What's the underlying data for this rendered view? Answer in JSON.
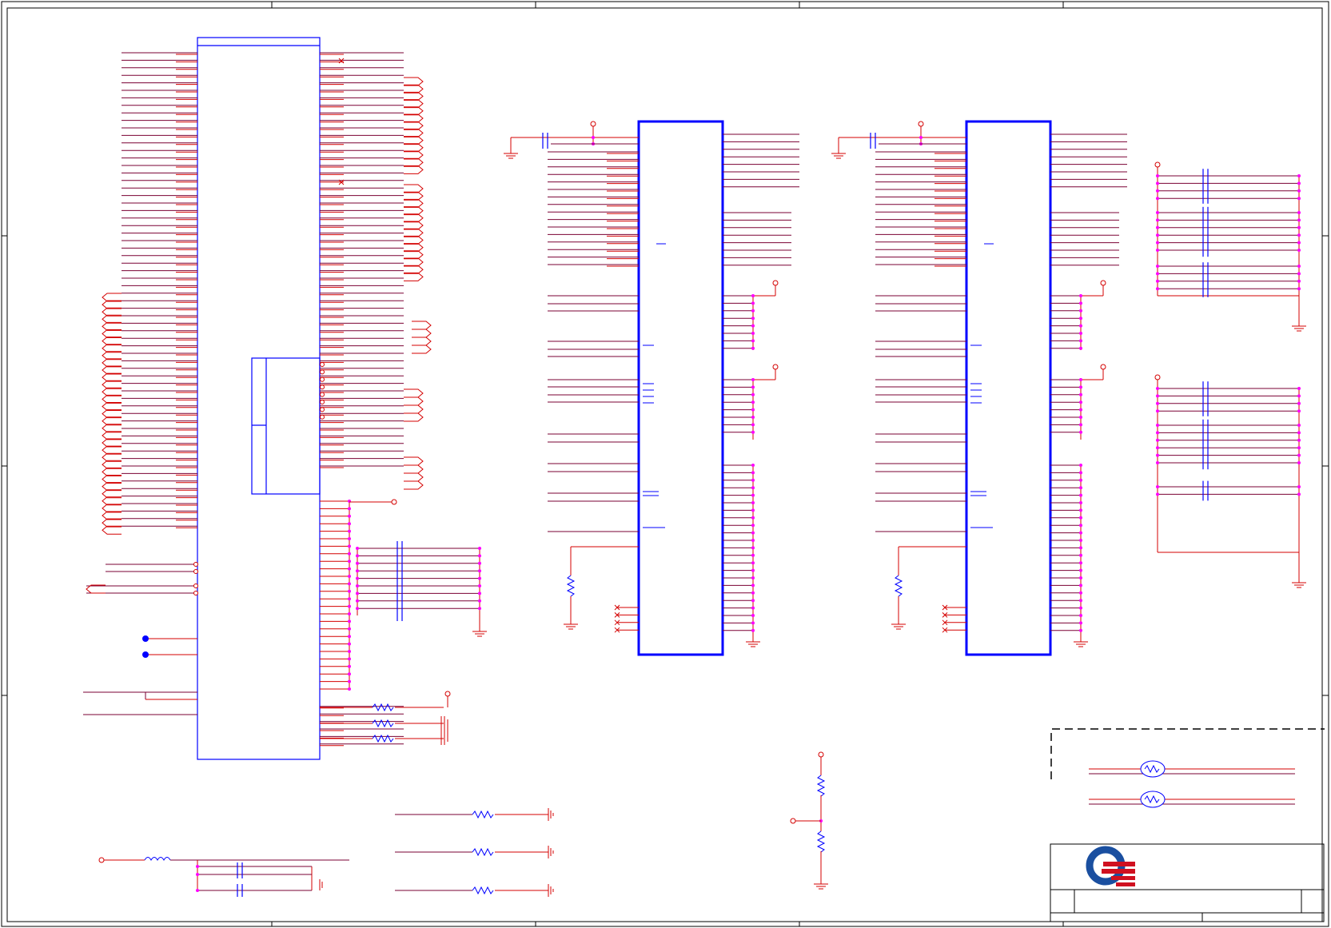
{
  "sheet": {
    "title": "",
    "frame_color": "#000000",
    "wire_color": "#d40000",
    "net_color": "#7a0033",
    "part_color": "#0000ff",
    "junction_color": "#ff00ff"
  },
  "logo": {
    "icon": "quanta-logo-icon",
    "ring_color": "#1a4fa0",
    "stripe_color": "#d01020"
  },
  "parts": {
    "main_ic": {
      "icon": "ic-symbol-icon"
    },
    "dimm_a": {
      "icon": "dimm-connector-icon"
    },
    "dimm_b": {
      "icon": "dimm-connector-icon"
    },
    "thermal_sensor": {
      "icon": "thermistor-icon"
    }
  }
}
